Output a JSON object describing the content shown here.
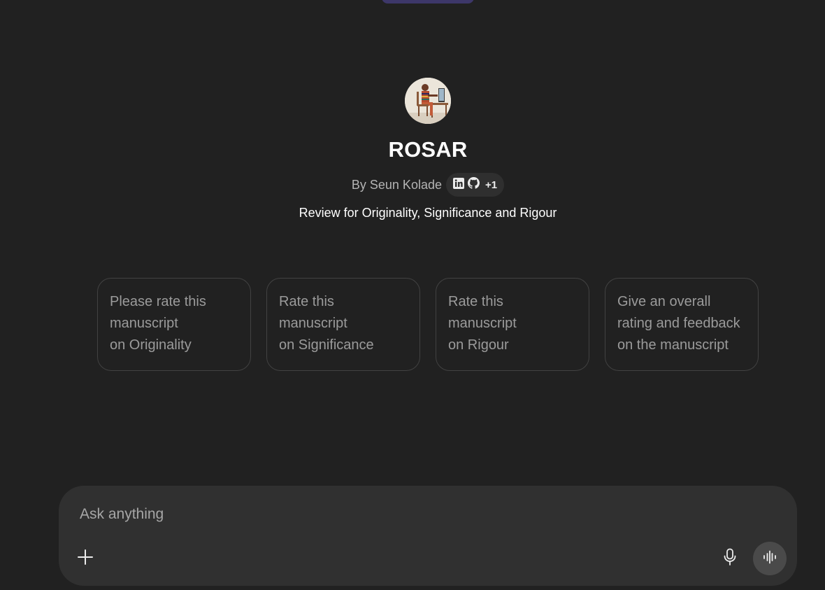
{
  "gpt": {
    "name": "ROSAR",
    "author": "By Seun Kolade",
    "social_icons": [
      "linkedin-icon",
      "github-icon"
    ],
    "social_more": "+1",
    "description": "Review for Originality, Significance and Rigour"
  },
  "starters": [
    {
      "text": "Please rate this\nmanuscript\non Originality"
    },
    {
      "text": "Rate this\nmanuscript\non Significance"
    },
    {
      "text": "Rate this\nmanuscript\non Rigour"
    },
    {
      "text": "Give an overall\nrating and feedback\non the manuscript"
    }
  ],
  "composer": {
    "placeholder": "Ask anything",
    "icons": [
      "plus-icon",
      "microphone-icon",
      "voice-mode-icon"
    ]
  },
  "colors": {
    "background": "#212121",
    "composer": "#303030",
    "card_border": "#424242",
    "top_pill": "#3d3769"
  }
}
